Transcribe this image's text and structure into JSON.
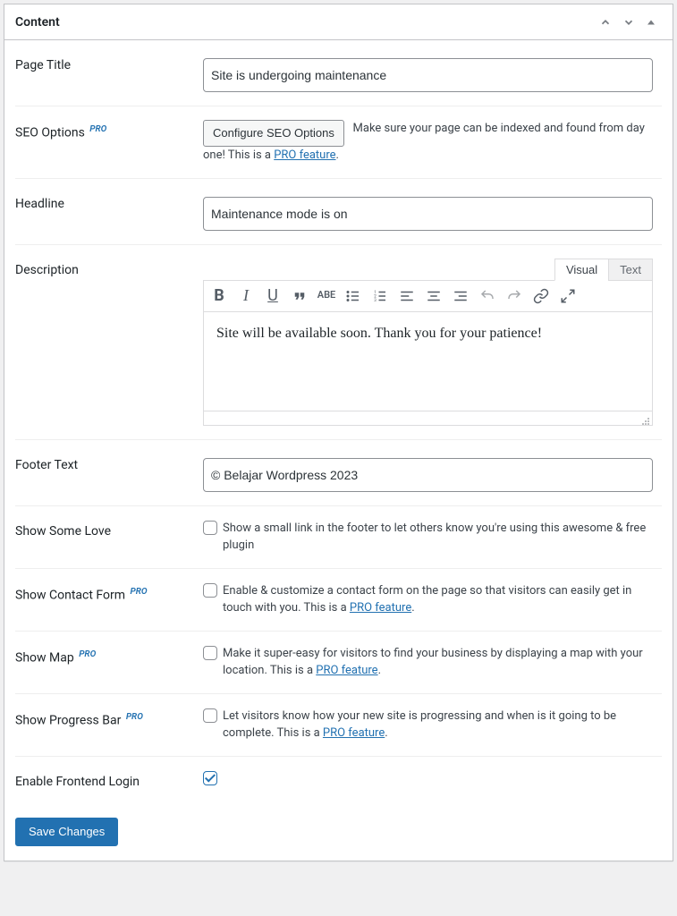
{
  "panel": {
    "title": "Content"
  },
  "fields": {
    "page_title": {
      "label": "Page Title",
      "value": "Site is undergoing maintenance"
    },
    "seo": {
      "label": "SEO Options ",
      "pro_badge": "PRO",
      "button": "Configure SEO Options",
      "desc_before": "Make sure your page can be indexed and found from day one! This is a ",
      "pro_link": "PRO feature",
      "desc_after": "."
    },
    "headline": {
      "label": "Headline",
      "value": "Maintenance mode is on"
    },
    "description": {
      "label": "Description",
      "tab_visual": "Visual",
      "tab_text": "Text",
      "content": "Site will be available soon. Thank you for your patience!"
    },
    "footer_text": {
      "label": "Footer Text",
      "value": "© Belajar Wordpress 2023"
    },
    "show_love": {
      "label": "Show Some Love",
      "desc": "Show a small link in the footer to let others know you're using this awesome & free plugin"
    },
    "contact_form": {
      "label": "Show Contact Form ",
      "pro_badge": "PRO",
      "desc_before": "Enable & customize a contact form on the page so that visitors can easily get in touch with you. This is a ",
      "pro_link": "PRO feature",
      "desc_after": "."
    },
    "show_map": {
      "label": "Show Map ",
      "pro_badge": "PRO",
      "desc_before": "Make it super-easy for visitors to find your business by displaying a map with your location. This is a ",
      "pro_link": "PRO feature",
      "desc_after": "."
    },
    "progress_bar": {
      "label": "Show Progress Bar ",
      "pro_badge": "PRO",
      "desc_before": "Let visitors know how your new site is progressing and when is it going to be complete. This is a ",
      "pro_link": "PRO feature",
      "desc_after": "."
    },
    "frontend_login": {
      "label": "Enable Frontend Login"
    }
  },
  "actions": {
    "save": "Save Changes"
  }
}
